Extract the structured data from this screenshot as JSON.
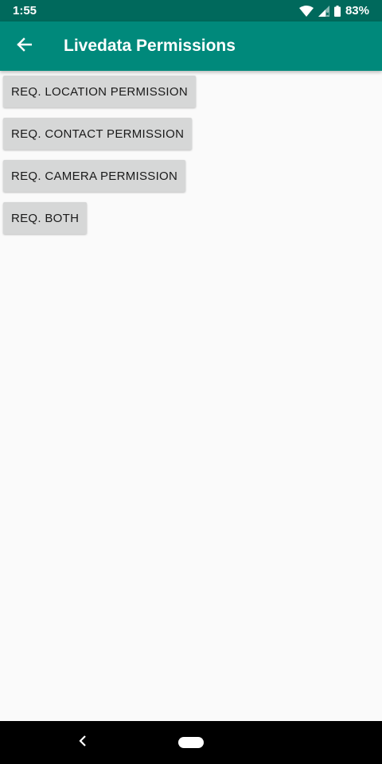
{
  "status_bar": {
    "time": "1:55",
    "battery": "83%",
    "icons": [
      "wifi-icon",
      "signal-icon",
      "battery-icon"
    ]
  },
  "app_bar": {
    "title": "Livedata Permissions",
    "back_icon": "arrow-back-icon",
    "color": "#00897b",
    "status_color": "#00695c"
  },
  "buttons": [
    {
      "label": "REQ. LOCATION PERMISSION"
    },
    {
      "label": "REQ. CONTACT PERMISSION"
    },
    {
      "label": "REQ. CAMERA PERMISSION"
    },
    {
      "label": "REQ. BOTH"
    }
  ],
  "nav_bar": {
    "icons": [
      "nav-back-icon",
      "nav-home-icon"
    ]
  }
}
